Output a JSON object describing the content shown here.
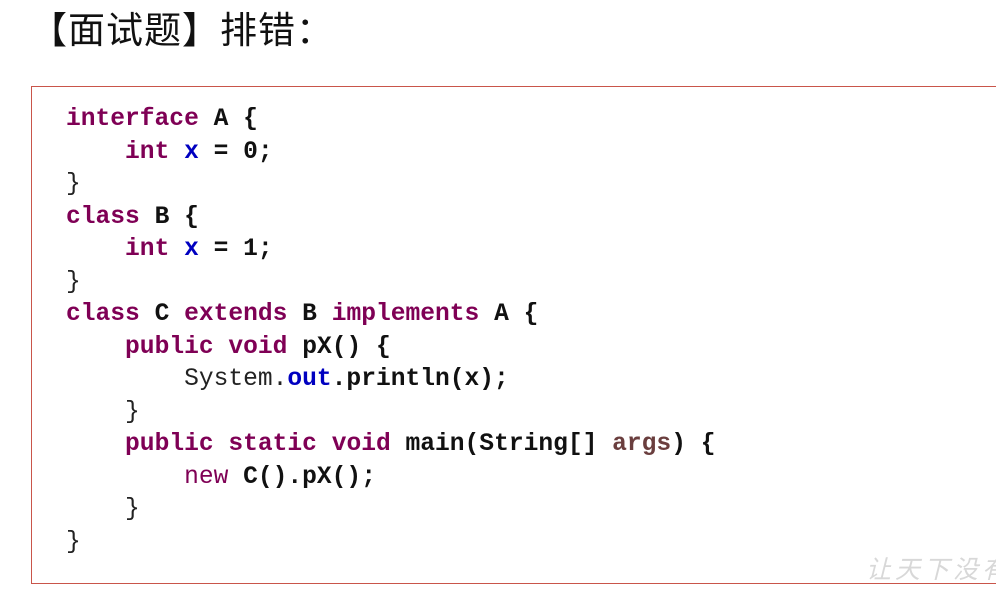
{
  "title": "【面试题】排错：",
  "code_lines": [
    [
      {
        "t": "interface",
        "c": "kw"
      },
      {
        "t": " ",
        "c": "plain"
      },
      {
        "t": "A",
        "c": "id"
      },
      {
        "t": " {",
        "c": "id"
      }
    ],
    [
      {
        "t": "    ",
        "c": "plain"
      },
      {
        "t": "int",
        "c": "kw"
      },
      {
        "t": " ",
        "c": "plain"
      },
      {
        "t": "x",
        "c": "field"
      },
      {
        "t": " = 0;",
        "c": "id"
      }
    ],
    [
      {
        "t": "}",
        "c": "plain"
      }
    ],
    [
      {
        "t": "class",
        "c": "kw"
      },
      {
        "t": " ",
        "c": "plain"
      },
      {
        "t": "B",
        "c": "id"
      },
      {
        "t": " {",
        "c": "id"
      }
    ],
    [
      {
        "t": "    ",
        "c": "plain"
      },
      {
        "t": "int",
        "c": "kw"
      },
      {
        "t": " ",
        "c": "plain"
      },
      {
        "t": "x",
        "c": "field"
      },
      {
        "t": " = 1;",
        "c": "id"
      }
    ],
    [
      {
        "t": "}",
        "c": "plain"
      }
    ],
    [
      {
        "t": "class",
        "c": "kw"
      },
      {
        "t": " ",
        "c": "plain"
      },
      {
        "t": "C",
        "c": "id"
      },
      {
        "t": " ",
        "c": "plain"
      },
      {
        "t": "extends",
        "c": "kw"
      },
      {
        "t": " ",
        "c": "plain"
      },
      {
        "t": "B",
        "c": "id"
      },
      {
        "t": " ",
        "c": "plain"
      },
      {
        "t": "implements",
        "c": "kw"
      },
      {
        "t": " ",
        "c": "plain"
      },
      {
        "t": "A",
        "c": "id"
      },
      {
        "t": " {",
        "c": "id"
      }
    ],
    [
      {
        "t": "    ",
        "c": "plain"
      },
      {
        "t": "public",
        "c": "kw"
      },
      {
        "t": " ",
        "c": "plain"
      },
      {
        "t": "void",
        "c": "kw"
      },
      {
        "t": " ",
        "c": "plain"
      },
      {
        "t": "pX() {",
        "c": "id"
      }
    ],
    [
      {
        "t": "        ",
        "c": "plain"
      },
      {
        "t": "System.",
        "c": "plain"
      },
      {
        "t": "out",
        "c": "field"
      },
      {
        "t": ".println(x);",
        "c": "id"
      }
    ],
    [
      {
        "t": "    }",
        "c": "plain"
      }
    ],
    [
      {
        "t": "    ",
        "c": "plain"
      },
      {
        "t": "public",
        "c": "kw"
      },
      {
        "t": " ",
        "c": "plain"
      },
      {
        "t": "static",
        "c": "kw"
      },
      {
        "t": " ",
        "c": "plain"
      },
      {
        "t": "void",
        "c": "kw"
      },
      {
        "t": " ",
        "c": "plain"
      },
      {
        "t": "main(String[]",
        "c": "id"
      },
      {
        "t": " ",
        "c": "plain"
      },
      {
        "t": "args",
        "c": "param"
      },
      {
        "t": ") {",
        "c": "id"
      }
    ],
    [
      {
        "t": "        ",
        "c": "plain"
      },
      {
        "t": "new",
        "c": "kwr"
      },
      {
        "t": " ",
        "c": "plain"
      },
      {
        "t": "C().pX();",
        "c": "id"
      }
    ],
    [
      {
        "t": "    }",
        "c": "plain"
      }
    ],
    [
      {
        "t": "}",
        "c": "plain"
      }
    ]
  ],
  "watermark": "让天下没有"
}
